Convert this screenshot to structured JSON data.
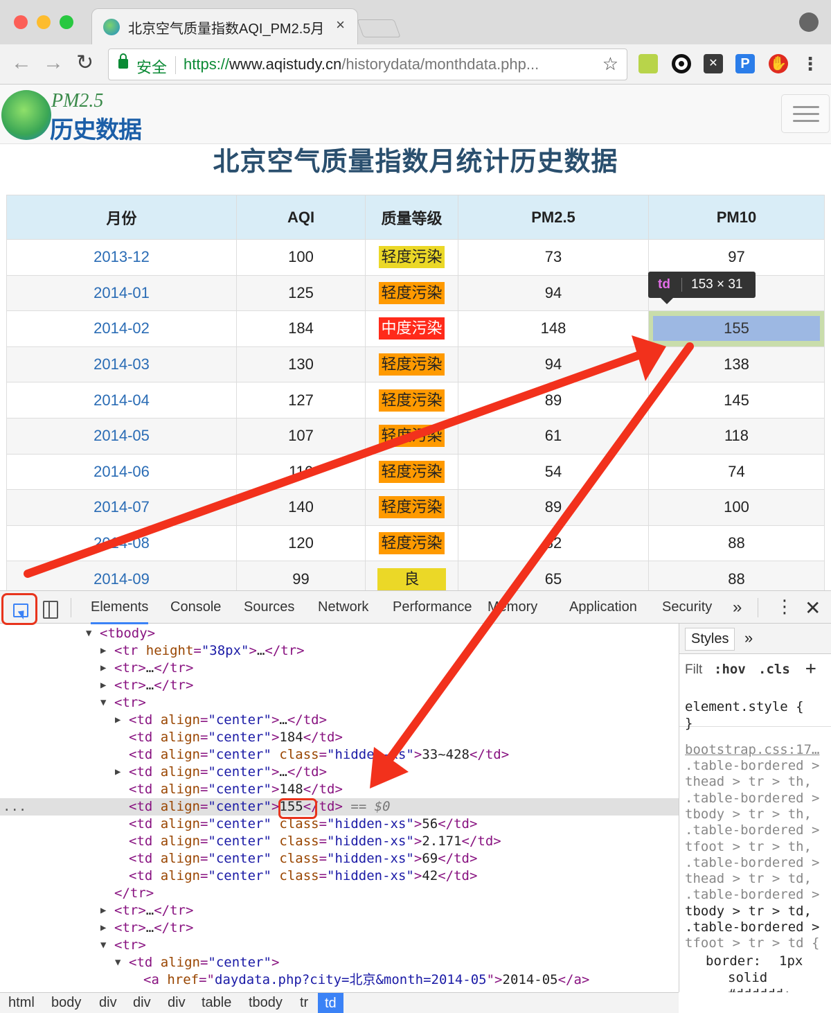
{
  "browser": {
    "tab_title": "北京空气质量指数AQI_PM2.5月",
    "security_label": "安全",
    "url_scheme": "https://",
    "url_host": "www.aqistudy.cn",
    "url_path": "/historydata/monthdata.php...",
    "icons": [
      "back-icon",
      "forward-icon",
      "reload-icon",
      "lock-icon",
      "star-icon",
      "profile-icon",
      "menu-icon"
    ]
  },
  "site": {
    "logo_top": "PM2.5",
    "logo_bottom": "历史数据",
    "page_title": "北京空气质量指数月统计历史数据"
  },
  "table": {
    "headers": [
      "月份",
      "AQI",
      "质量等级",
      "PM2.5",
      "PM10"
    ],
    "rows": [
      {
        "month": "2013-12",
        "aqi": "100",
        "level": "轻度污染",
        "level_color": "#ebd827",
        "pm25": "73",
        "pm10": "97"
      },
      {
        "month": "2014-01",
        "aqi": "125",
        "level": "轻度污染",
        "level_color": "#ff9a00",
        "pm25": "94",
        "pm10": ""
      },
      {
        "month": "2014-02",
        "aqi": "184",
        "level": "中度污染",
        "level_color": "#ff2a1a",
        "pm25": "148",
        "pm10": "155"
      },
      {
        "month": "2014-03",
        "aqi": "130",
        "level": "轻度污染",
        "level_color": "#ff9a00",
        "pm25": "94",
        "pm10": "138"
      },
      {
        "month": "2014-04",
        "aqi": "127",
        "level": "轻度污染",
        "level_color": "#ff9a00",
        "pm25": "89",
        "pm10": "145"
      },
      {
        "month": "2014-05",
        "aqi": "107",
        "level": "轻度污染",
        "level_color": "#ff9a00",
        "pm25": "61",
        "pm10": "118"
      },
      {
        "month": "2014-06",
        "aqi": "116",
        "level": "轻度污染",
        "level_color": "#ff9a00",
        "pm25": "54",
        "pm10": "74"
      },
      {
        "month": "2014-07",
        "aqi": "140",
        "level": "轻度污染",
        "level_color": "#ff9a00",
        "pm25": "89",
        "pm10": "100"
      },
      {
        "month": "2014-08",
        "aqi": "120",
        "level": "轻度污染",
        "level_color": "#ff9a00",
        "pm25": "82",
        "pm10": "88"
      },
      {
        "month": "2014-09",
        "aqi": "99",
        "level": "良",
        "level_color": "#ebd827",
        "pm25": "65",
        "pm10": "88"
      }
    ]
  },
  "tooltip": {
    "tag": "td",
    "size": "153 × 31"
  },
  "devtools": {
    "tabs": [
      "Elements",
      "Console",
      "Sources",
      "Network",
      "Performance",
      "Memory",
      "Application",
      "Security"
    ],
    "more": "»",
    "styles_tab": "Styles",
    "filter_label": "Filt",
    "hov": ":hov",
    "cls": ".cls",
    "breadcrumbs": [
      "html",
      "body",
      "div",
      "div",
      "div",
      "table",
      "tbody",
      "tr",
      "td"
    ],
    "selected_suffix": "== $0",
    "styles_lines": [
      "element.style {",
      "}",
      "bootstrap.css:17…",
      ".table-bordered >",
      "thead > tr > th,",
      ".table-bordered >",
      "tbody > tr > th,",
      ".table-bordered >",
      "tfoot > tr > th,",
      ".table-bordered >",
      "thead > tr > td,",
      ".table-bordered >",
      "tbody > tr > td,",
      ".table-bordered >",
      "tfoot > tr > td {",
      "border:",
      "1px",
      "solid",
      "#dddddd;",
      "}"
    ]
  },
  "dom_lines": [
    {
      "indent": 0,
      "tri": "▼",
      "parts": [
        [
          "tag",
          "<tbody>"
        ]
      ]
    },
    {
      "indent": 1,
      "tri": "▶",
      "parts": [
        [
          "tag",
          "<tr "
        ],
        [
          "an",
          "height"
        ],
        [
          "tag",
          "="
        ],
        [
          "av",
          "\"38px\""
        ],
        [
          "tag",
          ">"
        ],
        [
          "tx",
          "…"
        ],
        [
          "tag",
          "</tr>"
        ]
      ]
    },
    {
      "indent": 1,
      "tri": "▶",
      "parts": [
        [
          "tag",
          "<tr>"
        ],
        [
          "tx",
          "…"
        ],
        [
          "tag",
          "</tr>"
        ]
      ]
    },
    {
      "indent": 1,
      "tri": "▶",
      "parts": [
        [
          "tag",
          "<tr>"
        ],
        [
          "tx",
          "…"
        ],
        [
          "tag",
          "</tr>"
        ]
      ]
    },
    {
      "indent": 1,
      "tri": "▼",
      "parts": [
        [
          "tag",
          "<tr>"
        ]
      ]
    },
    {
      "indent": 2,
      "tri": "▶",
      "parts": [
        [
          "tag",
          "<td "
        ],
        [
          "an",
          "align"
        ],
        [
          "tag",
          "="
        ],
        [
          "av",
          "\"center\""
        ],
        [
          "tag",
          ">"
        ],
        [
          "tx",
          "…"
        ],
        [
          "tag",
          "</td>"
        ]
      ]
    },
    {
      "indent": 2,
      "tri": "",
      "parts": [
        [
          "tag",
          "<td "
        ],
        [
          "an",
          "align"
        ],
        [
          "tag",
          "="
        ],
        [
          "av",
          "\"center\""
        ],
        [
          "tag",
          ">"
        ],
        [
          "tx",
          "184"
        ],
        [
          "tag",
          "</td>"
        ]
      ]
    },
    {
      "indent": 2,
      "tri": "",
      "parts": [
        [
          "tag",
          "<td "
        ],
        [
          "an",
          "align"
        ],
        [
          "tag",
          "="
        ],
        [
          "av",
          "\"center\""
        ],
        [
          "tag",
          " "
        ],
        [
          "an",
          "class"
        ],
        [
          "tag",
          "="
        ],
        [
          "av",
          "\"hidden-xs\""
        ],
        [
          "tag",
          ">"
        ],
        [
          "tx",
          "33~428"
        ],
        [
          "tag",
          "</td>"
        ]
      ]
    },
    {
      "indent": 2,
      "tri": "▶",
      "parts": [
        [
          "tag",
          "<td "
        ],
        [
          "an",
          "align"
        ],
        [
          "tag",
          "="
        ],
        [
          "av",
          "\"center\""
        ],
        [
          "tag",
          ">"
        ],
        [
          "tx",
          "…"
        ],
        [
          "tag",
          "</td>"
        ]
      ]
    },
    {
      "indent": 2,
      "tri": "",
      "parts": [
        [
          "tag",
          "<td "
        ],
        [
          "an",
          "align"
        ],
        [
          "tag",
          "="
        ],
        [
          "av",
          "\"center\""
        ],
        [
          "tag",
          ">"
        ],
        [
          "tx",
          "148"
        ],
        [
          "tag",
          "</td>"
        ]
      ]
    },
    {
      "indent": 2,
      "tri": "",
      "sel": true,
      "parts": [
        [
          "tag",
          "<td "
        ],
        [
          "an",
          "align"
        ],
        [
          "tag",
          "="
        ],
        [
          "av",
          "\"center\""
        ],
        [
          "tag",
          ">"
        ],
        [
          "tx",
          "155"
        ],
        [
          "tag",
          "</td>"
        ]
      ]
    },
    {
      "indent": 2,
      "tri": "",
      "parts": [
        [
          "tag",
          "<td "
        ],
        [
          "an",
          "align"
        ],
        [
          "tag",
          "="
        ],
        [
          "av",
          "\"center\""
        ],
        [
          "tag",
          " "
        ],
        [
          "an",
          "class"
        ],
        [
          "tag",
          "="
        ],
        [
          "av",
          "\"hidden-xs\""
        ],
        [
          "tag",
          ">"
        ],
        [
          "tx",
          "56"
        ],
        [
          "tag",
          "</td>"
        ]
      ]
    },
    {
      "indent": 2,
      "tri": "",
      "parts": [
        [
          "tag",
          "<td "
        ],
        [
          "an",
          "align"
        ],
        [
          "tag",
          "="
        ],
        [
          "av",
          "\"center\""
        ],
        [
          "tag",
          " "
        ],
        [
          "an",
          "class"
        ],
        [
          "tag",
          "="
        ],
        [
          "av",
          "\"hidden-xs\""
        ],
        [
          "tag",
          ">"
        ],
        [
          "tx",
          "2.171"
        ],
        [
          "tag",
          "</td>"
        ]
      ]
    },
    {
      "indent": 2,
      "tri": "",
      "parts": [
        [
          "tag",
          "<td "
        ],
        [
          "an",
          "align"
        ],
        [
          "tag",
          "="
        ],
        [
          "av",
          "\"center\""
        ],
        [
          "tag",
          " "
        ],
        [
          "an",
          "class"
        ],
        [
          "tag",
          "="
        ],
        [
          "av",
          "\"hidden-xs\""
        ],
        [
          "tag",
          ">"
        ],
        [
          "tx",
          "69"
        ],
        [
          "tag",
          "</td>"
        ]
      ]
    },
    {
      "indent": 2,
      "tri": "",
      "parts": [
        [
          "tag",
          "<td "
        ],
        [
          "an",
          "align"
        ],
        [
          "tag",
          "="
        ],
        [
          "av",
          "\"center\""
        ],
        [
          "tag",
          " "
        ],
        [
          "an",
          "class"
        ],
        [
          "tag",
          "="
        ],
        [
          "av",
          "\"hidden-xs\""
        ],
        [
          "tag",
          ">"
        ],
        [
          "tx",
          "42"
        ],
        [
          "tag",
          "</td>"
        ]
      ]
    },
    {
      "indent": 1,
      "tri": "",
      "parts": [
        [
          "tag",
          "</tr>"
        ]
      ]
    },
    {
      "indent": 1,
      "tri": "▶",
      "parts": [
        [
          "tag",
          "<tr>"
        ],
        [
          "tx",
          "…"
        ],
        [
          "tag",
          "</tr>"
        ]
      ]
    },
    {
      "indent": 1,
      "tri": "▶",
      "parts": [
        [
          "tag",
          "<tr>"
        ],
        [
          "tx",
          "…"
        ],
        [
          "tag",
          "</tr>"
        ]
      ]
    },
    {
      "indent": 1,
      "tri": "▼",
      "parts": [
        [
          "tag",
          "<tr>"
        ]
      ]
    },
    {
      "indent": 2,
      "tri": "▼",
      "parts": [
        [
          "tag",
          "<td "
        ],
        [
          "an",
          "align"
        ],
        [
          "tag",
          "="
        ],
        [
          "av",
          "\"center\""
        ],
        [
          "tag",
          ">"
        ]
      ]
    },
    {
      "indent": 3,
      "tri": "",
      "parts": [
        [
          "tag",
          "<a "
        ],
        [
          "an",
          "href"
        ],
        [
          "tag",
          "="
        ],
        [
          "tag",
          "\""
        ],
        [
          "av",
          "daydata.php?city=北京&month=2014-05"
        ],
        [
          "tag",
          "\">"
        ],
        [
          "tx",
          "2014-05"
        ],
        [
          "tag",
          "</a>"
        ]
      ]
    }
  ]
}
